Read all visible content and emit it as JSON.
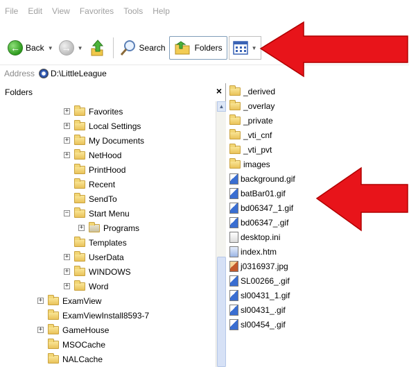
{
  "menu": [
    "File",
    "Edit",
    "View",
    "Favorites",
    "Tools",
    "Help"
  ],
  "toolbar": {
    "back_label": "Back",
    "search_label": "Search",
    "folders_label": "Folders"
  },
  "address": {
    "label": "Address",
    "value": "D:\\LittleLeague"
  },
  "folders_pane": {
    "title": "Folders",
    "close": "×",
    "tree": [
      {
        "label": "Favorites",
        "exp": "+"
      },
      {
        "label": "Local Settings",
        "exp": "+"
      },
      {
        "label": "My Documents",
        "exp": "+"
      },
      {
        "label": "NetHood",
        "exp": "+"
      },
      {
        "label": "PrintHood",
        "exp": ""
      },
      {
        "label": "Recent",
        "exp": ""
      },
      {
        "label": "SendTo",
        "exp": ""
      },
      {
        "label": "Start Menu",
        "exp": "−"
      },
      {
        "label": "Programs",
        "exp": "+"
      },
      {
        "label": "Templates",
        "exp": ""
      },
      {
        "label": "UserData",
        "exp": "+"
      },
      {
        "label": "WINDOWS",
        "exp": "+"
      },
      {
        "label": "Word",
        "exp": "+"
      },
      {
        "label": "ExamView",
        "exp": "+"
      },
      {
        "label": "ExamViewInstall8593-7",
        "exp": ""
      },
      {
        "label": "GameHouse",
        "exp": "+"
      },
      {
        "label": "MSOCache",
        "exp": ""
      },
      {
        "label": "NALCache",
        "exp": ""
      }
    ]
  },
  "files": [
    {
      "name": "_derived",
      "type": "folder"
    },
    {
      "name": "_overlay",
      "type": "folder"
    },
    {
      "name": "_private",
      "type": "folder"
    },
    {
      "name": "_vti_cnf",
      "type": "folder"
    },
    {
      "name": "_vti_pvt",
      "type": "folder"
    },
    {
      "name": "images",
      "type": "folder"
    },
    {
      "name": "background.gif",
      "type": "gif"
    },
    {
      "name": "batBar01.gif",
      "type": "gif"
    },
    {
      "name": "bd06347_1.gif",
      "type": "gif"
    },
    {
      "name": "bd06347_.gif",
      "type": "gif"
    },
    {
      "name": "desktop.ini",
      "type": "ini"
    },
    {
      "name": "index.htm",
      "type": "htm"
    },
    {
      "name": "j0316937.jpg",
      "type": "jpg"
    },
    {
      "name": "SL00266_.gif",
      "type": "gif"
    },
    {
      "name": "sl00431_1.gif",
      "type": "gif"
    },
    {
      "name": "sl00431_.gif",
      "type": "gif"
    },
    {
      "name": "sl00454_.gif",
      "type": "gif"
    }
  ],
  "colors": {
    "annotation_arrow": "#e8141a"
  }
}
